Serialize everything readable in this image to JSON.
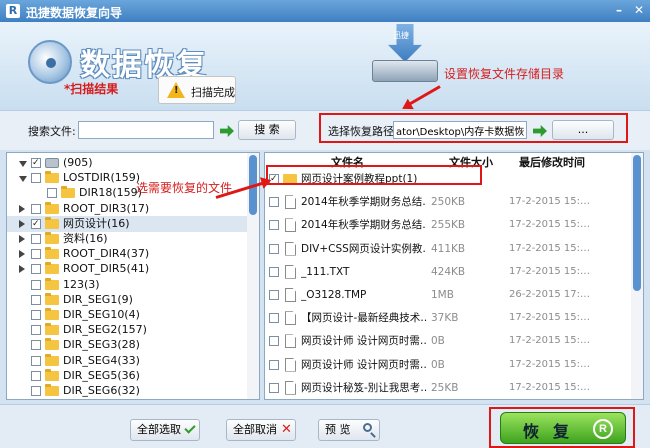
{
  "window": {
    "title": "迅捷数据恢复向导",
    "app_icon": "R"
  },
  "banner": {
    "title": "数据恢复",
    "scan_result_label": "*扫描结果",
    "scan_status": "扫描完成",
    "drive_text": "迅捷",
    "annotation_store": "设置恢复文件存储目录"
  },
  "search": {
    "label": "搜索文件:",
    "value": "",
    "button": "搜 索",
    "path_label": "选择恢复路径",
    "path_value": "ator\\Desktop\\内存卡数据恢复",
    "browse_button": "..."
  },
  "tree": {
    "annotation": "选需要恢复的文件",
    "items": [
      {
        "label": "(905)",
        "checked": true,
        "expanded": true,
        "icon": "drive-icon"
      },
      {
        "label": "LOSTDIR(159)",
        "checked": false,
        "expanded": true,
        "icon": "folder-icon"
      },
      {
        "label": "DIR18(159)",
        "checked": false,
        "expanded": null,
        "icon": "folder-icon"
      },
      {
        "label": "ROOT_DIR3(17)",
        "checked": false,
        "expanded": false,
        "icon": "folder-icon"
      },
      {
        "label": "网页设计(16)",
        "checked": true,
        "expanded": false,
        "icon": "folder-icon",
        "selected": true
      },
      {
        "label": "资料(16)",
        "checked": false,
        "expanded": false,
        "icon": "folder-icon"
      },
      {
        "label": "ROOT_DIR4(37)",
        "checked": false,
        "expanded": false,
        "icon": "folder-icon"
      },
      {
        "label": "ROOT_DIR5(41)",
        "checked": false,
        "expanded": false,
        "icon": "folder-icon"
      },
      {
        "label": "123(3)",
        "checked": false,
        "expanded": null,
        "icon": "folder-icon"
      },
      {
        "label": "DIR_SEG1(9)",
        "checked": false,
        "expanded": null,
        "icon": "folder-icon"
      },
      {
        "label": "DIR_SEG10(4)",
        "checked": false,
        "expanded": null,
        "icon": "folder-icon"
      },
      {
        "label": "DIR_SEG2(157)",
        "checked": false,
        "expanded": null,
        "icon": "folder-icon"
      },
      {
        "label": "DIR_SEG3(28)",
        "checked": false,
        "expanded": null,
        "icon": "folder-icon"
      },
      {
        "label": "DIR_SEG4(33)",
        "checked": false,
        "expanded": null,
        "icon": "folder-icon"
      },
      {
        "label": "DIR_SEG5(36)",
        "checked": false,
        "expanded": null,
        "icon": "folder-icon"
      },
      {
        "label": "DIR_SEG6(32)",
        "checked": false,
        "expanded": null,
        "icon": "folder-icon"
      }
    ]
  },
  "files": {
    "columns": [
      "文件名",
      "文件大小",
      "最后修改时间"
    ],
    "rows": [
      {
        "name": "网页设计案例教程ppt(1)",
        "size": "",
        "time": "",
        "checked": true,
        "icon": "folder-icon"
      },
      {
        "name": "2014年秋季学期财务总结…",
        "size": "250KB",
        "time": "17-2-2015 15:…",
        "checked": false,
        "icon": "document-icon"
      },
      {
        "name": "2014年秋季学期财务总结…",
        "size": "255KB",
        "time": "17-2-2015 15:…",
        "checked": false,
        "icon": "document-icon"
      },
      {
        "name": "DIV+CSS网页设计实例教…",
        "size": "411KB",
        "time": "17-2-2015 15:…",
        "checked": false,
        "icon": "document-icon"
      },
      {
        "name": "_111.TXT",
        "size": "424KB",
        "time": "17-2-2015 15:…",
        "checked": false,
        "icon": "document-icon"
      },
      {
        "name": "_O3128.TMP",
        "size": "1MB",
        "time": "26-2-2015 17:…",
        "checked": false,
        "icon": "document-icon"
      },
      {
        "name": "【网页设计-最新经典技术…",
        "size": "37KB",
        "time": "17-2-2015 15:…",
        "checked": false,
        "icon": "document-icon"
      },
      {
        "name": "网页设计师 设计网页时需…",
        "size": "0B",
        "time": "17-2-2015 15:…",
        "checked": false,
        "icon": "document-icon"
      },
      {
        "name": "网页设计师 设计网页时需…",
        "size": "0B",
        "time": "17-2-2015 15:…",
        "checked": false,
        "icon": "document-icon"
      },
      {
        "name": "网页设计秘笈-別让我思考…",
        "size": "25KB",
        "time": "17-2-2015 15:…",
        "checked": false,
        "icon": "document-icon"
      }
    ]
  },
  "footer": {
    "select_all": "全部选取",
    "deselect_all": "全部取消",
    "preview": "预 览",
    "recover": "恢复",
    "recover_icon": "R"
  },
  "colors": {
    "accent": "#3f7fc2",
    "annotation": "#d61d1d",
    "recover_green": "#3ea31f"
  }
}
